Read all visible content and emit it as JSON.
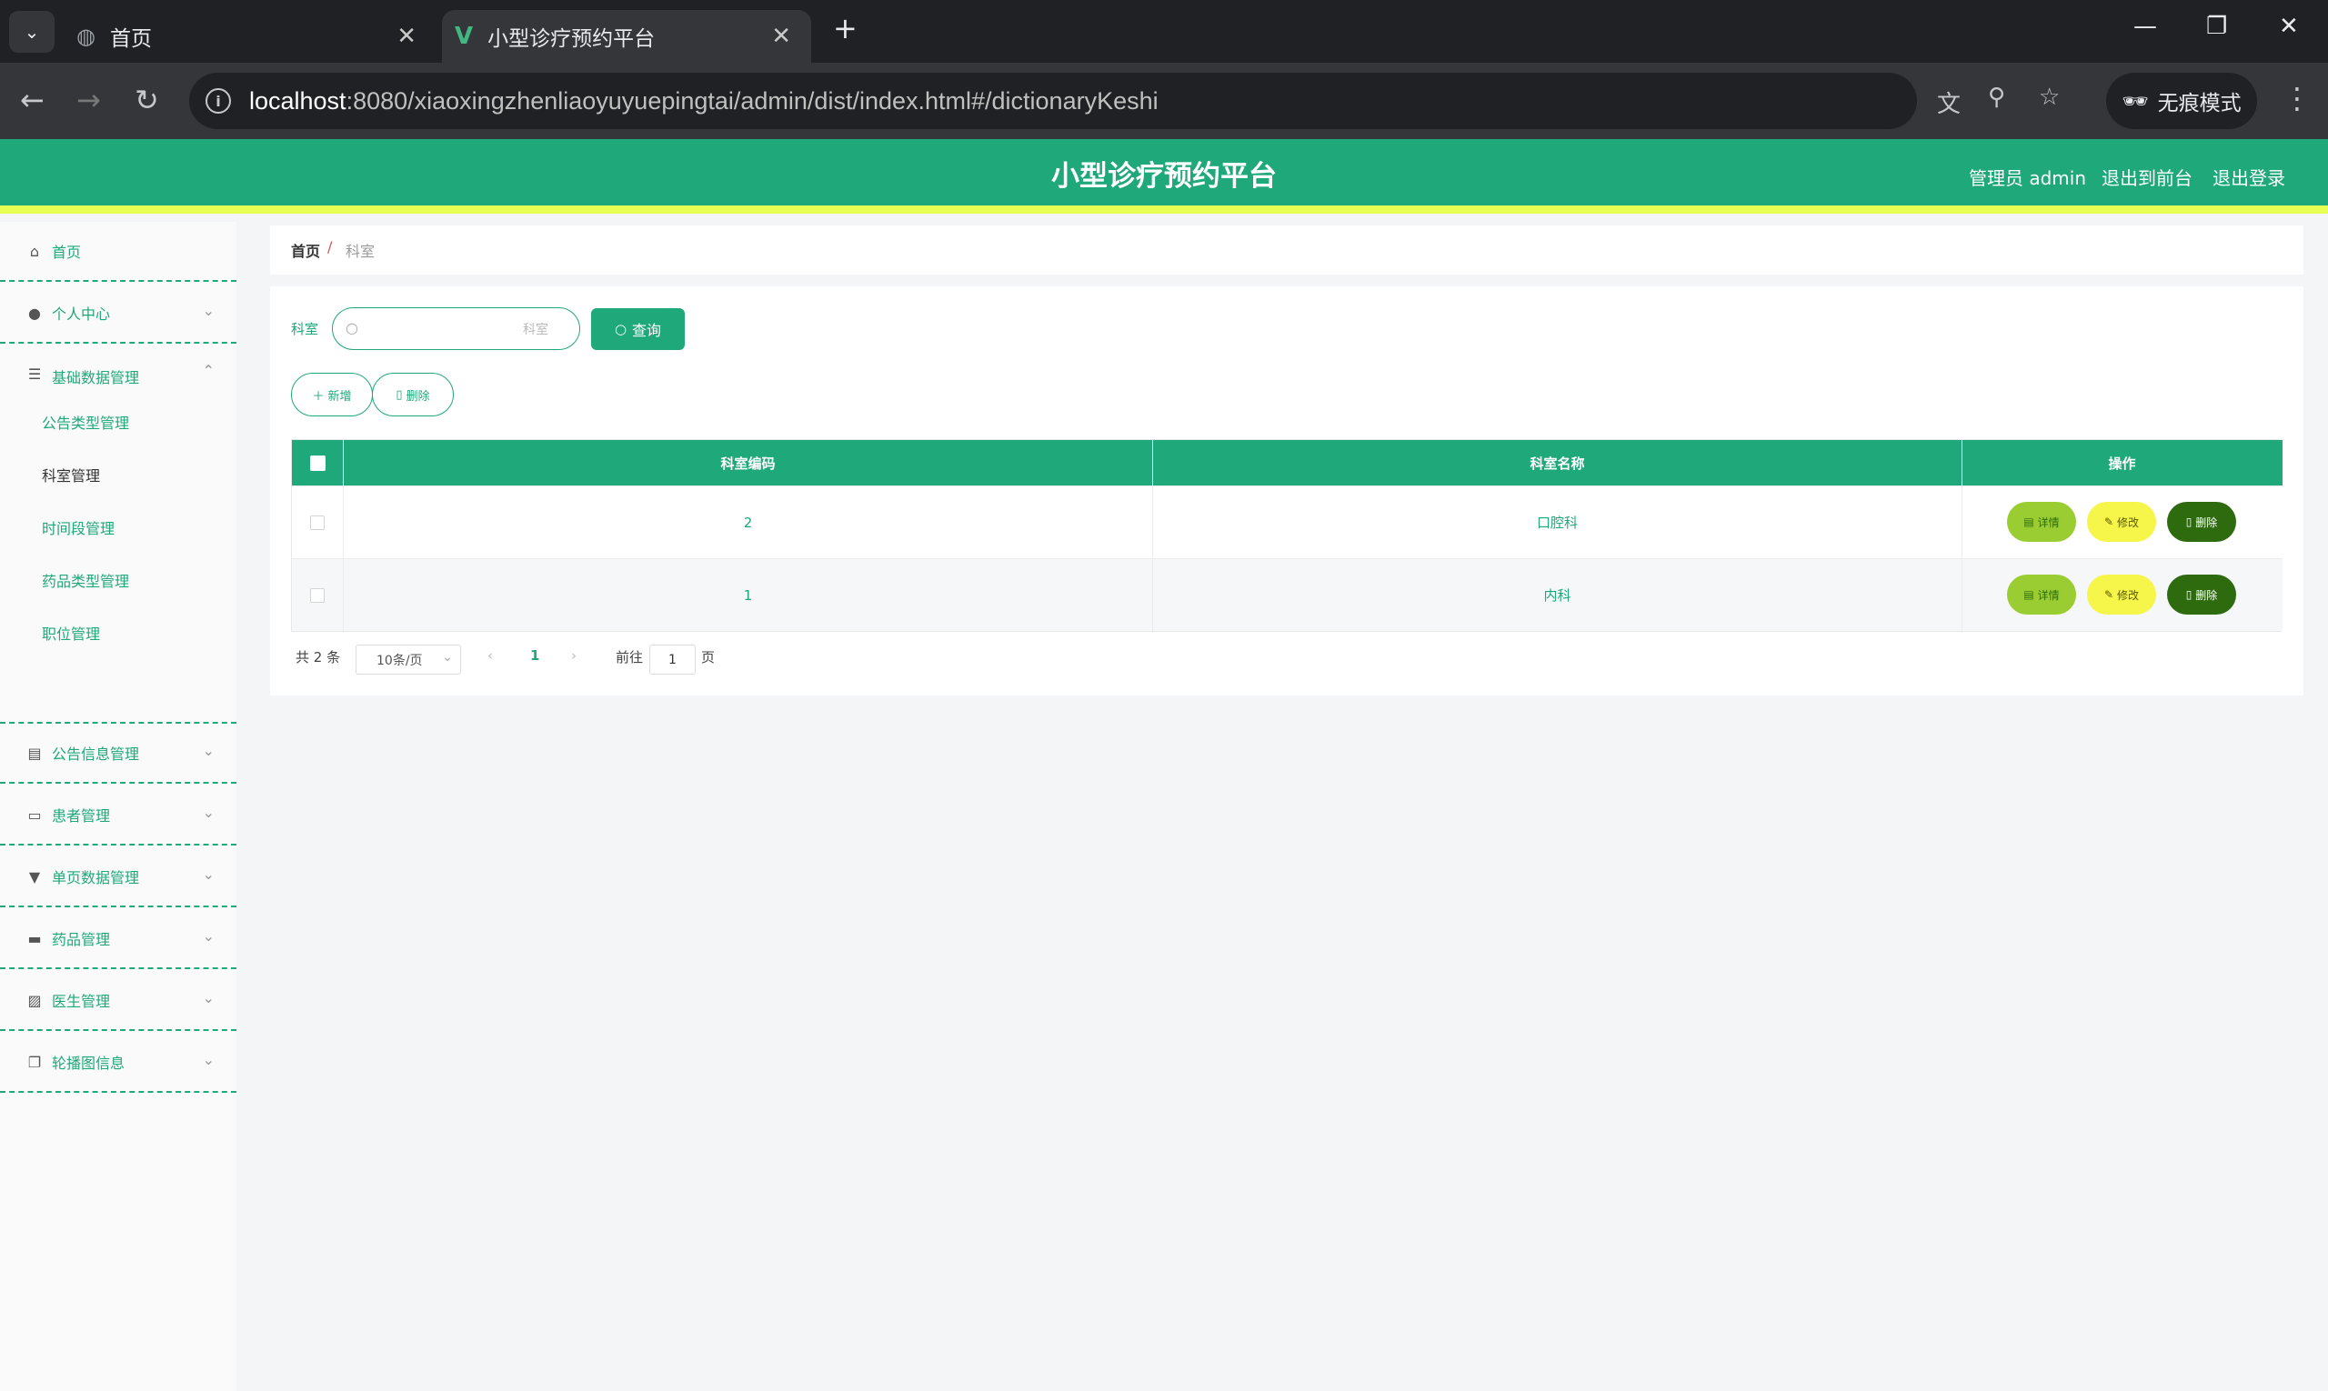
{
  "browser": {
    "tabs": [
      {
        "title": "首页"
      },
      {
        "title": "小型诊疗预约平台"
      }
    ],
    "url_host": "localhost",
    "url_path": ":8080/xiaoxingzhenliaoyuyuepingtai/admin/dist/index.html#/dictionaryKeshi",
    "incognito_label": "无痕模式"
  },
  "header": {
    "title": "小型诊疗预约平台",
    "user": "管理员 admin",
    "to_front": "退出到前台",
    "logout": "退出登录"
  },
  "sidebar": {
    "items": [
      {
        "label": "首页",
        "icon": "home-icon"
      },
      {
        "label": "个人中心",
        "icon": "user-icon"
      },
      {
        "label": "基础数据管理",
        "icon": "menu-icon",
        "expanded": true
      },
      {
        "label": "公告信息管理",
        "icon": "clipboard-icon"
      },
      {
        "label": "患者管理",
        "icon": "chat-icon"
      },
      {
        "label": "单页数据管理",
        "icon": "pin-icon"
      },
      {
        "label": "药品管理",
        "icon": "briefcase-icon"
      },
      {
        "label": "医生管理",
        "icon": "chart-icon"
      },
      {
        "label": "轮播图信息",
        "icon": "copy-icon"
      }
    ],
    "sub_items": [
      "公告类型管理",
      "科室管理",
      "时间段管理",
      "药品类型管理",
      "职位管理"
    ]
  },
  "breadcrumb": {
    "home": "首页",
    "sep": "/",
    "current": "科室"
  },
  "search": {
    "label": "科室",
    "placeholder": "科室",
    "button": "查询"
  },
  "actions": {
    "add": "新增",
    "delete": "删除"
  },
  "table": {
    "headers": [
      "科室编码",
      "科室名称",
      "操作"
    ],
    "rows": [
      {
        "code": "2",
        "name": "口腔科"
      },
      {
        "code": "1",
        "name": "内科"
      }
    ],
    "row_actions": {
      "detail": "详情",
      "edit": "修改",
      "delete": "删除"
    }
  },
  "pagination": {
    "total": "共 2 条",
    "page_size": "10条/页",
    "current_page": "1",
    "goto_label": "前往",
    "goto_value": "1",
    "page_suffix": "页"
  },
  "colors": {
    "primary": "#1fa87a",
    "accent": "#e8ff53",
    "detail_btn": "#9acd32",
    "edit_btn": "#f5f54a",
    "delete_btn": "#2e6b0f"
  }
}
